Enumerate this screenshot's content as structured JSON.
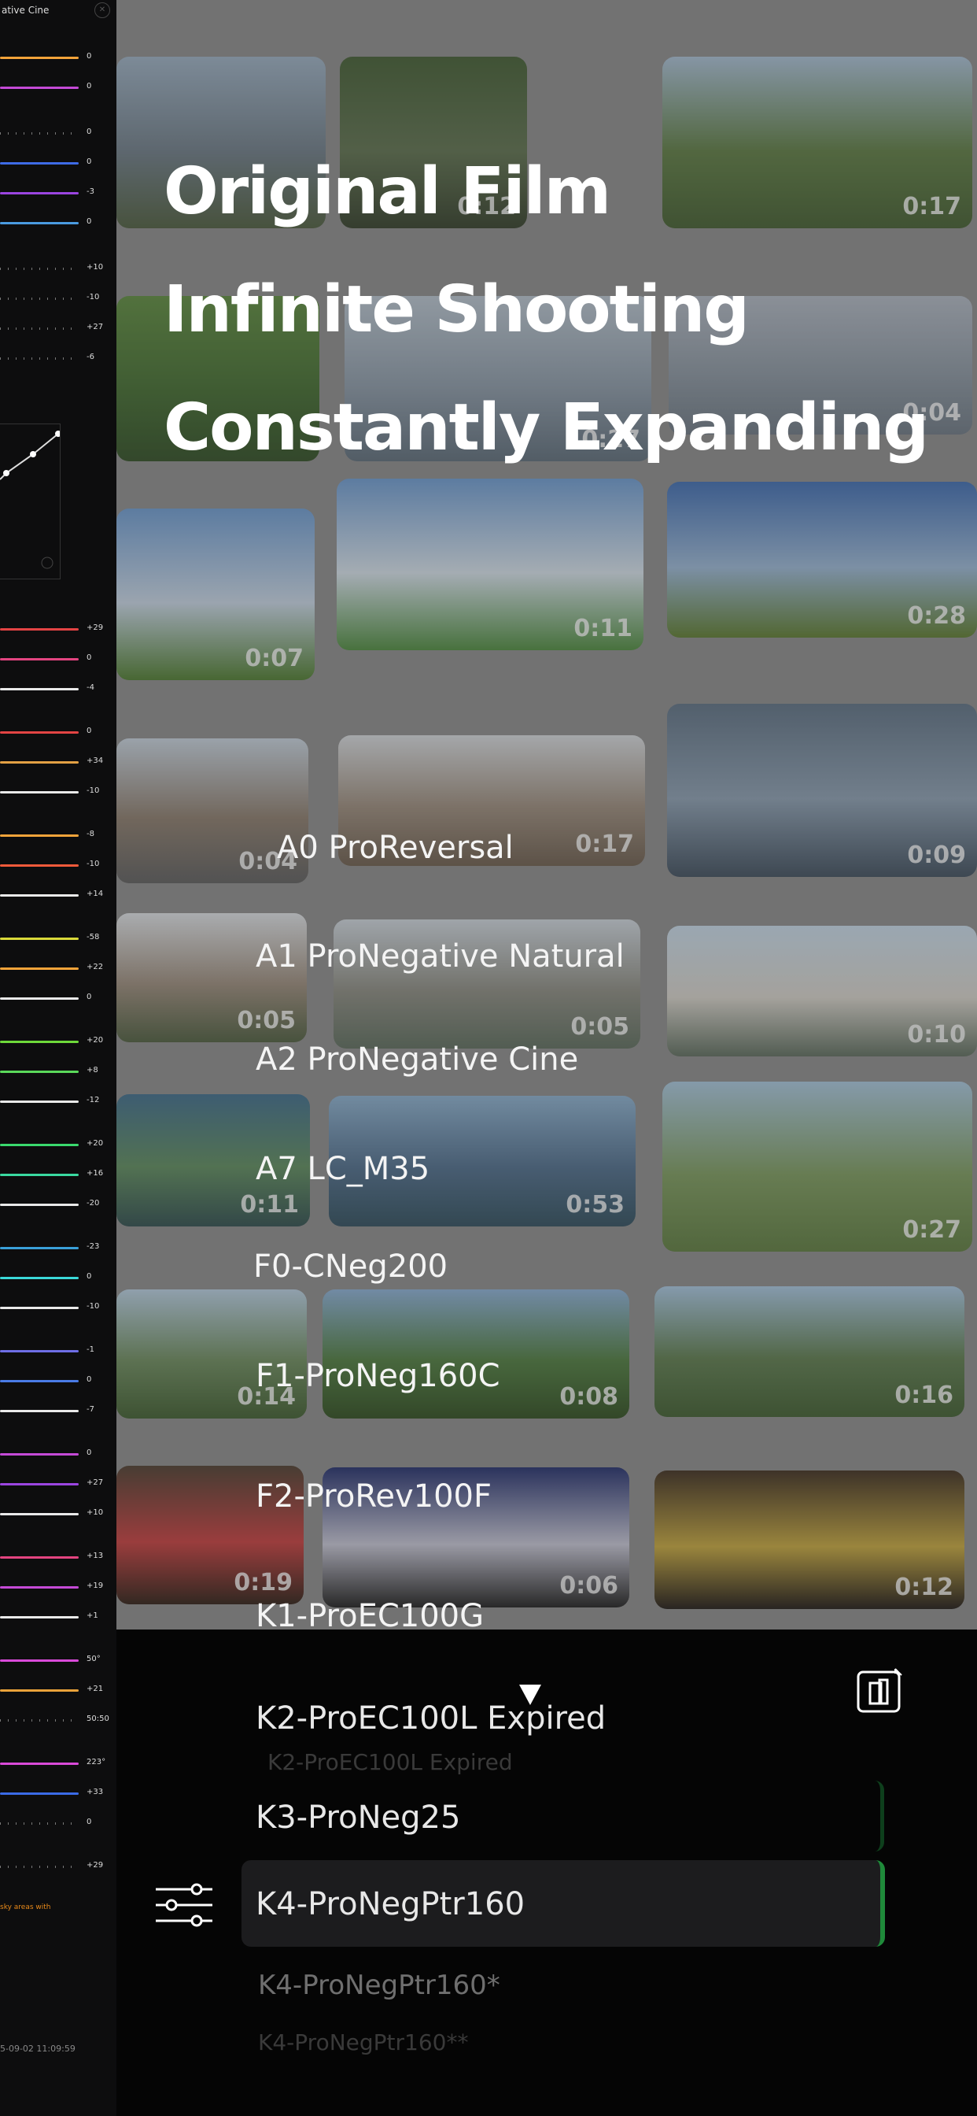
{
  "panel": {
    "title": "ative Cine",
    "slider_groups": [
      {
        "items": [
          {
            "value": "0",
            "color": "#f2a33a"
          },
          {
            "value": "0",
            "color": "#c44ad6"
          }
        ]
      },
      {
        "items": [
          {
            "value": "0",
            "color": "ticks"
          },
          {
            "value": "0",
            "color": "#3e6be6"
          },
          {
            "value": "-3",
            "color": "#9b45e0"
          },
          {
            "value": "0",
            "color": "#4a9be0"
          }
        ]
      },
      {
        "items": [
          {
            "value": "+10",
            "color": "ticks"
          },
          {
            "value": "-10",
            "color": "ticks"
          },
          {
            "value": "+27",
            "color": "ticks"
          },
          {
            "value": "-6",
            "color": "ticks"
          }
        ]
      }
    ],
    "slider_rows": [
      {
        "value": "+29",
        "color": "#e34444"
      },
      {
        "value": "0",
        "color": "#e34480"
      },
      {
        "value": "-4",
        "color": "#e9e9e9"
      },
      {
        "value": "0",
        "color": "#e34444"
      },
      {
        "value": "+34",
        "color": "#e3a044"
      },
      {
        "value": "-10",
        "color": "#e9e9e9"
      },
      {
        "value": "-8",
        "color": "#f2a33a"
      },
      {
        "value": "-10",
        "color": "#f25a3a"
      },
      {
        "value": "+14",
        "color": "#e9e9e9"
      },
      {
        "value": "-58",
        "color": "#d9d93a"
      },
      {
        "value": "+22",
        "color": "#f2a33a"
      },
      {
        "value": "0",
        "color": "#e9e9e9"
      },
      {
        "value": "+20",
        "color": "#6ed93a"
      },
      {
        "value": "+8",
        "color": "#5ad95a"
      },
      {
        "value": "-12",
        "color": "#e9e9e9"
      },
      {
        "value": "+20",
        "color": "#3ad96e"
      },
      {
        "value": "+16",
        "color": "#3ad9a0"
      },
      {
        "value": "-20",
        "color": "#e9e9e9"
      },
      {
        "value": "-23",
        "color": "#3aa0d9"
      },
      {
        "value": "0",
        "color": "#3ad9d9"
      },
      {
        "value": "-10",
        "color": "#e9e9e9"
      },
      {
        "value": "-1",
        "color": "#6e6ee6"
      },
      {
        "value": "0",
        "color": "#4a7be6"
      },
      {
        "value": "-7",
        "color": "#e9e9e9"
      },
      {
        "value": "0",
        "color": "#c44ad6"
      },
      {
        "value": "+27",
        "color": "#9b45e0"
      },
      {
        "value": "+10",
        "color": "#e9e9e9"
      },
      {
        "value": "+13",
        "color": "#e34480"
      },
      {
        "value": "+19",
        "color": "#c44ad6"
      },
      {
        "value": "+1",
        "color": "#e9e9e9"
      },
      {
        "value": "50°",
        "color": "#d94ad9"
      },
      {
        "value": "+21",
        "color": "#e9a23a"
      },
      {
        "value": "50:50",
        "color": "ticks"
      },
      {
        "value": "223°",
        "color": "#d94ad9"
      },
      {
        "value": "+33",
        "color": "#3a6be6"
      },
      {
        "value": "0",
        "color": "ticks"
      },
      {
        "value": "+29",
        "color": "ticks"
      }
    ],
    "note": "sky areas with",
    "timestamp": "5-09-02 11:09:59"
  },
  "headlines": [
    "Original Film",
    "Infinite Shooting",
    "Constantly Expanding"
  ],
  "thumbnails": [
    {
      "duration": "",
      "colors": [
        "#9bb0c4",
        "#6b7a86",
        "#4a5a3a"
      ]
    },
    {
      "duration": "0:12",
      "colors": [
        "#3e5a2e",
        "#5a6e4a",
        "#2e3a24"
      ]
    },
    {
      "duration": "0:17",
      "colors": [
        "#a9c1d8",
        "#5a7a3e",
        "#3e5a2a"
      ]
    },
    {
      "duration": "",
      "colors": [
        "#5a8a3a",
        "#3e6a2a",
        "#2a4a1e"
      ]
    },
    {
      "duration": "0:27",
      "colors": [
        "#b9c6d2",
        "#8a99a8",
        "#5a6a78"
      ]
    },
    {
      "duration": "0:04",
      "colors": [
        "#b0b8c4",
        "#8a96a2",
        "#6a7682"
      ]
    },
    {
      "duration": "0:07",
      "colors": [
        "#6a9ad2",
        "#c9d8e8",
        "#4a7a2a"
      ]
    },
    {
      "duration": "0:11",
      "colors": [
        "#6a9ad2",
        "#d8e4ee",
        "#4a8a3a"
      ]
    },
    {
      "duration": "0:28",
      "colors": [
        "#3a6ab2",
        "#9ab8d8",
        "#5a7a2a"
      ]
    },
    {
      "duration": "0:04",
      "colors": [
        "#c8d4e0",
        "#8a7a6a",
        "#5a5a5a"
      ]
    },
    {
      "duration": "0:17",
      "colors": [
        "#d8dce0",
        "#9a8a7a",
        "#6a5a4a"
      ]
    },
    {
      "duration": "0:09",
      "colors": [
        "#5a6e82",
        "#8a9eb2",
        "#3a4a5a"
      ]
    },
    {
      "duration": "0:05",
      "colors": [
        "#e0e4e8",
        "#9a8a7a",
        "#4a5a3a"
      ]
    },
    {
      "duration": "0:05",
      "colors": [
        "#d0d8e0",
        "#8a8a80",
        "#5a6a5a"
      ]
    },
    {
      "duration": "0:10",
      "colors": [
        "#c8dcec",
        "#d8d4cc",
        "#5a6a5a"
      ]
    },
    {
      "duration": "0:11",
      "colors": [
        "#3a6a8a",
        "#5a8a5a",
        "#2a4a4a"
      ]
    },
    {
      "duration": "0:53",
      "colors": [
        "#8ab0d0",
        "#4a6a8a",
        "#2a4a5a"
      ]
    },
    {
      "duration": "0:27",
      "colors": [
        "#a8c8e0",
        "#7a9a5a",
        "#5a7a3a"
      ]
    },
    {
      "duration": "0:14",
      "colors": [
        "#b8d0e4",
        "#6a8a5a",
        "#3a5a2a"
      ]
    },
    {
      "duration": "0:08",
      "colors": [
        "#8ab0d8",
        "#4a7a3a",
        "#2a4a1a"
      ]
    },
    {
      "duration": "0:16",
      "colors": [
        "#a8c8e4",
        "#5a7a4a",
        "#3a5a2a"
      ]
    },
    {
      "duration": "0:19",
      "colors": [
        "#4a3a2a",
        "#c83a3a",
        "#2a1a10"
      ]
    },
    {
      "duration": "0:06",
      "colors": [
        "#1e2a6a",
        "#c8c8d8",
        "#1a1a1a"
      ]
    },
    {
      "duration": "0:12",
      "colors": [
        "#3a2a1a",
        "#c8a83a",
        "#1a1410"
      ]
    }
  ],
  "film_list_overlay": [
    "A0 ProReversal",
    "A1 ProNegative Natural",
    "A2 ProNegative Cine",
    "A7 LC_M35",
    "F0-CNeg200",
    "F1-ProNeg160C",
    "F2-ProRev100F",
    "K1-ProEC100G"
  ],
  "picker": {
    "ghost_item": "K2-ProEC100L Expired",
    "items": [
      {
        "label": "K2-ProEC100L Expired",
        "style": "normal"
      },
      {
        "label": "K3-ProNeg25",
        "style": "normal"
      },
      {
        "label": "K4-ProNegPtr160",
        "style": "selected"
      },
      {
        "label": "K4-ProNegPtr160*",
        "style": "dim"
      },
      {
        "label": "K4-ProNegPtr160**",
        "style": "faint"
      }
    ],
    "accent_color": "#1f8a3a"
  }
}
